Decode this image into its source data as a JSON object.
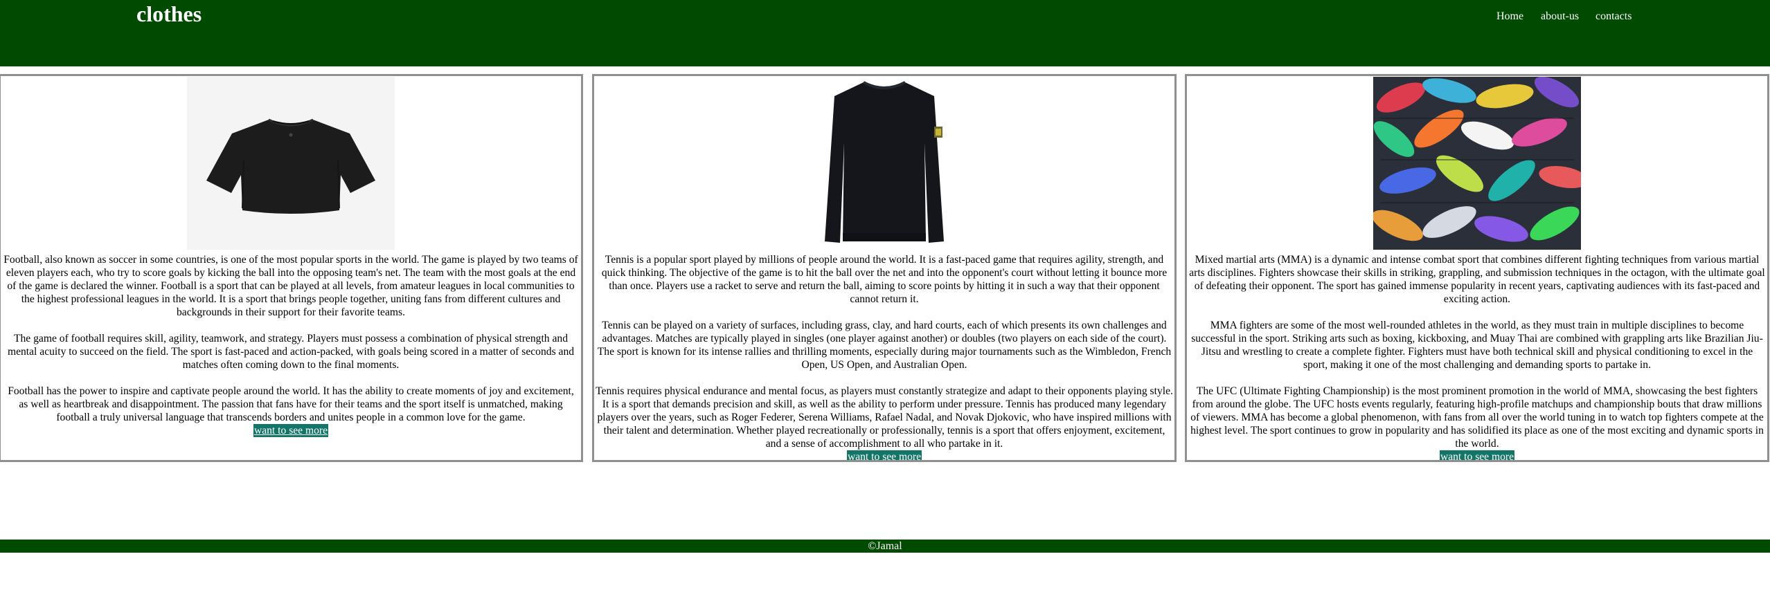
{
  "header": {
    "brand": "clothes",
    "nav": [
      {
        "label": "Home"
      },
      {
        "label": "about-us"
      },
      {
        "label": "contacts"
      }
    ]
  },
  "cards": [
    {
      "image": "black-tshirt-photo",
      "paragraphs": [
        "Football, also known as soccer in some countries, is one of the most popular sports in the world. The game is played by two teams of eleven players each, who try to score goals by kicking the ball into the opposing team's net. The team with the most goals at the end of the game is declared the winner. Football is a sport that can be played at all levels, from amateur leagues in local communities to the highest professional leagues in the world. It is a sport that brings people together, uniting fans from different cultures and backgrounds in their support for their favorite teams.",
        "The game of football requires skill, agility, teamwork, and strategy. Players must possess a combination of physical strength and mental acuity to succeed on the field. The sport is fast-paced and action-packed, with goals being scored in a matter of seconds and matches often coming down to the final moments.",
        "Football has the power to inspire and captivate people around the world. It has the ability to create moments of joy and excitement, as well as heartbreak and disappointment. The passion that fans have for their teams and the sport itself is unmatched, making football a truly universal language that transcends borders and unites people in a common love for the game."
      ],
      "button": "want to see more"
    },
    {
      "image": "black-sweater-photo",
      "paragraphs": [
        "Tennis is a popular sport played by millions of people around the world. It is a fast-paced game that requires agility, strength, and quick thinking. The objective of the game is to hit the ball over the net and into the opponent's court without letting it bounce more than once. Players use a racket to serve and return the ball, aiming to score points by hitting it in such a way that their opponent cannot return it.",
        "Tennis can be played on a variety of surfaces, including grass, clay, and hard courts, each of which presents its own challenges and advantages. Matches are typically played in singles (one player against another) or doubles (two players on each side of the court). The sport is known for its intense rallies and thrilling moments, especially during major tournaments such as the Wimbledon, French Open, US Open, and Australian Open.",
        "Tennis requires physical endurance and mental focus, as players must constantly strategize and adapt to their opponents playing style. It is a sport that demands precision and skill, as well as the ability to perform under pressure. Tennis has produced many legendary players over the years, such as Roger Federer, Serena Williams, Rafael Nadal, and Novak Djokovic, who have inspired millions with their talent and determination. Whether played recreationally or professionally, tennis is a sport that offers enjoyment, excitement, and a sense of accomplishment to all who partake in it."
      ],
      "button": "want to see more"
    },
    {
      "image": "sneakers-pile-photo",
      "paragraphs": [
        "Mixed martial arts (MMA) is a dynamic and intense combat sport that combines different fighting techniques from various martial arts disciplines. Fighters showcase their skills in striking, grappling, and submission techniques in the octagon, with the ultimate goal of defeating their opponent. The sport has gained immense popularity in recent years, captivating audiences with its fast-paced and exciting action.",
        "MMA fighters are some of the most well-rounded athletes in the world, as they must train in multiple disciplines to become successful in the sport. Striking arts such as boxing, kickboxing, and Muay Thai are combined with grappling arts like Brazilian Jiu-Jitsu and wrestling to create a complete fighter. Fighters must have both technical skill and physical conditioning to excel in the sport, making it one of the most challenging and demanding sports to partake in.",
        "The UFC (Ultimate Fighting Championship) is the most prominent promotion in the world of MMA, showcasing the best fighters from around the globe. The UFC hosts events regularly, featuring high-profile matchups and championship bouts that draw millions of viewers. MMA has become a global phenomenon, with fans from all over the world tuning in to watch top fighters compete at the highest level. The sport continues to grow in popularity and has solidified its place as one of the most exciting and dynamic sports in the world."
      ],
      "button": "want to see more"
    }
  ],
  "footer": {
    "text": "©Jamal"
  }
}
